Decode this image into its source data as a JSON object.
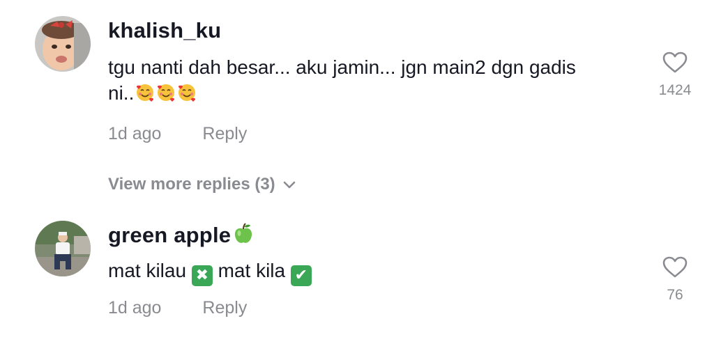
{
  "comments": [
    {
      "username": "khalish_ku",
      "text_line1": "tgu nanti dah besar... aku jamin... jgn main2 dgn gadis",
      "text_line2": "ni..",
      "text_emojis": "🥰🥰🥰",
      "time": "1d ago",
      "reply_label": "Reply",
      "like_count": "1424",
      "avatar_icon": "baby-portrait-avatar"
    },
    {
      "username": "green apple",
      "username_emoji": "green-apple-icon",
      "text_part1": "mat kilau",
      "cross_badge": "✖",
      "text_part2": "mat kila",
      "check_badge": "✔",
      "time": "1d ago",
      "reply_label": "Reply",
      "like_count": "76",
      "avatar_icon": "man-sitting-photo-avatar"
    }
  ],
  "view_more": {
    "label": "View more replies (3)",
    "icon": "chevron-down-icon"
  },
  "colors": {
    "primary_text": "#161823",
    "secondary_text": "#8a8b91",
    "badge_green": "#3aa757"
  }
}
